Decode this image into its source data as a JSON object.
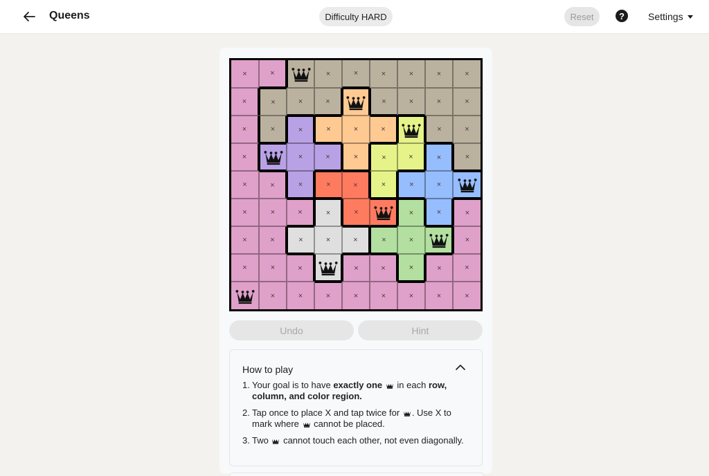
{
  "header": {
    "title": "Queens",
    "difficulty": "Difficulty HARD",
    "reset_label": "Reset",
    "help_label": "?",
    "settings_label": "Settings"
  },
  "board": {
    "size": 9,
    "x_mark": "×",
    "regions": [
      [
        "pink",
        "pink",
        "tan",
        "tan",
        "tan",
        "tan",
        "tan",
        "tan",
        "tan"
      ],
      [
        "pink",
        "tan",
        "tan",
        "tan",
        "orange",
        "tan",
        "tan",
        "tan",
        "tan"
      ],
      [
        "pink",
        "tan",
        "purple",
        "orange",
        "orange",
        "orange",
        "lime",
        "tan",
        "tan"
      ],
      [
        "pink",
        "purple",
        "purple",
        "purple",
        "orange",
        "lime",
        "lime",
        "blue",
        "tan"
      ],
      [
        "pink",
        "pink",
        "purple",
        "red",
        "red",
        "lime",
        "blue",
        "blue",
        "blue"
      ],
      [
        "pink",
        "pink",
        "pink",
        "gray",
        "red",
        "red",
        "green",
        "blue",
        "pink"
      ],
      [
        "pink",
        "pink",
        "gray",
        "gray",
        "gray",
        "green",
        "green",
        "green",
        "pink"
      ],
      [
        "pink",
        "pink",
        "pink",
        "gray",
        "pink",
        "pink",
        "green",
        "pink",
        "pink"
      ],
      [
        "pink",
        "pink",
        "pink",
        "pink",
        "pink",
        "pink",
        "pink",
        "pink",
        "pink"
      ]
    ],
    "queens": [
      [
        0,
        2
      ],
      [
        1,
        4
      ],
      [
        2,
        6
      ],
      [
        3,
        1
      ],
      [
        4,
        8
      ],
      [
        5,
        5
      ],
      [
        6,
        7
      ],
      [
        7,
        3
      ],
      [
        8,
        0
      ]
    ],
    "colors": {
      "pink": "#dfa0c9",
      "tan": "#bab29f",
      "orange": "#ffc992",
      "purple": "#b9a1e5",
      "lime": "#e6f389",
      "blue": "#96bdfe",
      "red": "#ff7b60",
      "gray": "#dfdfdf",
      "green": "#b3dfa0"
    }
  },
  "controls": {
    "undo_label": "Undo",
    "hint_label": "Hint"
  },
  "how_to_play": {
    "title": "How to play",
    "rule1": {
      "num": "1.",
      "a": "Your goal is to have ",
      "b": "exactly one",
      "c": " in each ",
      "d": "row, column, and color region."
    },
    "rule2": {
      "num": "2.",
      "a": "Tap once to place X and tap twice for ",
      "b": ". Use X to mark where ",
      "c": " cannot be placed."
    },
    "rule3": {
      "num": "3.",
      "a": "Two ",
      "b": " cannot touch each other, not even diagonally."
    }
  }
}
